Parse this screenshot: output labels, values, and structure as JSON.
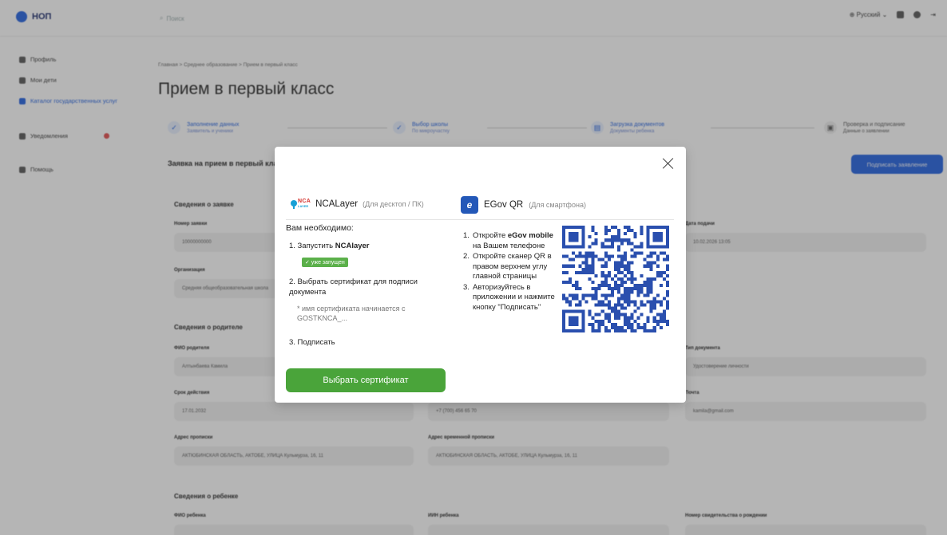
{
  "app": {
    "logo_text": "НОП",
    "search_placeholder": "Поиск",
    "language": "Русский"
  },
  "sidebar": {
    "items": [
      {
        "label": "Профиль"
      },
      {
        "label": "Мои дети"
      },
      {
        "label": "Каталог государственных услуг"
      },
      {
        "label": "Уведомления"
      },
      {
        "label": "Помощь"
      }
    ]
  },
  "page": {
    "breadcrumb": "Главная  >  Среднее образование  >  Прием в первый класс",
    "title": "Прием в первый класс",
    "steps": [
      {
        "title": "Заполнение данных",
        "subtitle": "Заявитель и ученики"
      },
      {
        "title": "Выбор школы",
        "subtitle": "По микроучастку"
      },
      {
        "title": "Загрузка документов",
        "subtitle": "Документы ребенка"
      },
      {
        "title": "Проверка и подписание",
        "subtitle": "Данные о заявлении"
      }
    ],
    "form_title": "Заявка на прием в первый класс",
    "submit_label": "Подписать заявление",
    "sections": {
      "application": "Сведения о заявке",
      "parent": "Сведения о родителе",
      "child": "Сведения о ребенке"
    },
    "fields": {
      "app_number_label": "Номер заявки",
      "app_number_value": "10000000000",
      "date_label": "Дата подачи",
      "date_value": "10.02.2026 13:05",
      "org_label": "Организация",
      "org_value": "Средняя общеобразовательная школа",
      "parent_name_label": "ФИО родителя",
      "parent_name_value": "Алтынбаева Камила",
      "doc_type_label": "Тип документа",
      "doc_type_value": "Удостоверение личности",
      "validity_label": "Срок действия",
      "validity_value": "17.01.2032",
      "phone_value": "+7 (700) 456 65 70",
      "email_label": "Почта",
      "email_value": "kamila@gmail.com",
      "reg_address_label": "Адрес прописки",
      "reg_address_value": "АКТЮБИНСКАЯ ОБЛАСТЬ, АКТОБЕ, УЛИЦА Кульмурза, 16, 11",
      "actual_address_label": "Адрес временной прописки",
      "actual_address_value": "АКТЮБИНСКАЯ ОБЛАСТЬ, АКТОБЕ, УЛИЦА Кульмурза, 16, 11",
      "child_name_label": "ФИО ребенка",
      "child_iin_label": "ИИН ребенка",
      "child_cert_label": "Номер свидетельства о рождении"
    }
  },
  "modal": {
    "nca_tab": {
      "logo_top": "NCA",
      "logo_bottom": "LAYER",
      "title": "NCALayer",
      "subtitle": "(Для десктоп / ПК)"
    },
    "egov_tab": {
      "logo": "e",
      "title": "EGov QR",
      "subtitle": "(Для смартфона)"
    },
    "need_label": "Вам необходимо:",
    "steps": {
      "s1_prefix": "1. Запустить ",
      "s1_bold": "NCAlayer",
      "running_badge": "✓ уже запущен",
      "s2": "2. Выбрать сертификат для подписи документа",
      "hint": "* имя сертификата начинается с GOSTKNCA_...",
      "s3": "3. Подписать"
    },
    "choose_button": "Выбрать сертификат",
    "egov_steps": {
      "n1": "1.",
      "t1_a": "Откройте ",
      "t1_b": "eGov mobile",
      "t1_c": " на Вашем телефоне",
      "n2": "2.",
      "t2": "Откройте сканер QR в правом верхнем углу главной страницы",
      "n3": "3.",
      "t3": "Авторизуйтесь в приложении и нажмите кнопку \"Подписать\""
    }
  }
}
